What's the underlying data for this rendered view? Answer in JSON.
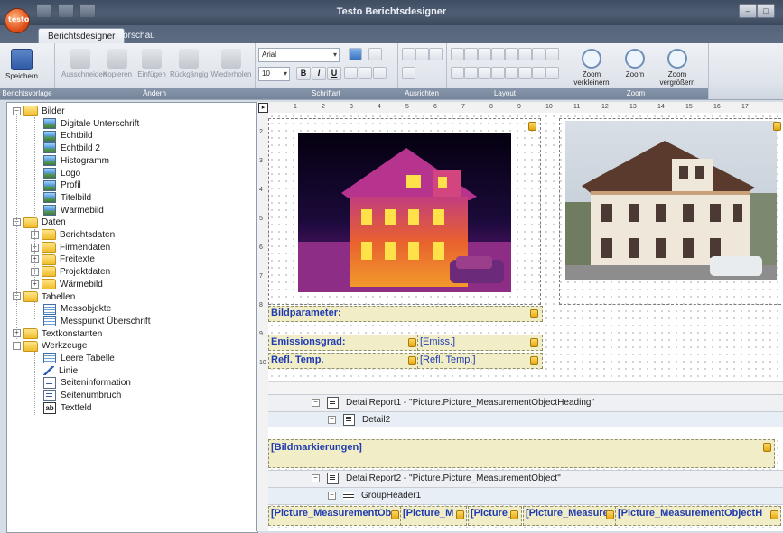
{
  "window": {
    "title": "Testo Berichtsdesigner",
    "logo_text": "testo",
    "buttons": [
      "–",
      "□",
      "✕"
    ]
  },
  "tabs": [
    {
      "label": "Berichtsdesigner",
      "active": true
    },
    {
      "label": "Vorschau",
      "active": false
    }
  ],
  "ribbon": {
    "groups": {
      "berichtsvorlage": {
        "label": "Berichtsvorlage",
        "save_label": "Speichern"
      },
      "aendern": {
        "label": "Ändern",
        "buttons": [
          "Ausschneiden",
          "Kopieren",
          "Einfügen",
          "Rückgängig",
          "Wiederholen"
        ]
      },
      "schriftart": {
        "label": "Schriftart",
        "font": "Arial",
        "size": "10",
        "bold": "B",
        "italic": "I",
        "underline": "U"
      },
      "ausrichten": {
        "label": "Ausrichten"
      },
      "layout": {
        "label": "Layout"
      },
      "zoom": {
        "label": "Zoom",
        "buttons": [
          "Zoom verkleinern",
          "Zoom",
          "Zoom vergrößern"
        ]
      }
    }
  },
  "tree": {
    "nodes": [
      {
        "label": "Bilder",
        "level": 0,
        "kind": "folder",
        "exp": "−"
      },
      {
        "label": "Digitale Unterschrift",
        "level": 1,
        "kind": "img"
      },
      {
        "label": "Echtbild",
        "level": 1,
        "kind": "img"
      },
      {
        "label": "Echtbild 2",
        "level": 1,
        "kind": "img"
      },
      {
        "label": "Histogramm",
        "level": 1,
        "kind": "img"
      },
      {
        "label": "Logo",
        "level": 1,
        "kind": "img"
      },
      {
        "label": "Profil",
        "level": 1,
        "kind": "img"
      },
      {
        "label": "Titelbild",
        "level": 1,
        "kind": "img"
      },
      {
        "label": "Wärmebild",
        "level": 1,
        "kind": "img"
      },
      {
        "label": "Daten",
        "level": 0,
        "kind": "folder",
        "exp": "−"
      },
      {
        "label": "Berichtsdaten",
        "level": 1,
        "kind": "folder",
        "exp": "+"
      },
      {
        "label": "Firmendaten",
        "level": 1,
        "kind": "folder",
        "exp": "+"
      },
      {
        "label": "Freitexte",
        "level": 1,
        "kind": "folder",
        "exp": "+"
      },
      {
        "label": "Projektdaten",
        "level": 1,
        "kind": "folder",
        "exp": "+"
      },
      {
        "label": "Wärmebild",
        "level": 1,
        "kind": "folder",
        "exp": "+"
      },
      {
        "label": "Tabellen",
        "level": 0,
        "kind": "folder",
        "exp": "−"
      },
      {
        "label": "Messobjekte",
        "level": 1,
        "kind": "table"
      },
      {
        "label": "Messpunkt Überschrift",
        "level": 1,
        "kind": "table"
      },
      {
        "label": "Textkonstanten",
        "level": 0,
        "kind": "folder",
        "exp": "+"
      },
      {
        "label": "Werkzeuge",
        "level": 0,
        "kind": "folder",
        "exp": "−"
      },
      {
        "label": "Leere Tabelle",
        "level": 1,
        "kind": "table"
      },
      {
        "label": "Linie",
        "level": 1,
        "kind": "line"
      },
      {
        "label": "Seiteninformation",
        "level": 1,
        "kind": "info"
      },
      {
        "label": "Seitenumbruch",
        "level": 1,
        "kind": "info"
      },
      {
        "label": "Textfeld",
        "level": 1,
        "kind": "txt",
        "icon_text": "ab"
      }
    ]
  },
  "designer": {
    "ruler_button": "▸",
    "ruler_numbers": [
      "1",
      "2",
      "3",
      "4",
      "5",
      "6",
      "7",
      "8",
      "9",
      "10",
      "11",
      "12",
      "13",
      "14",
      "15",
      "16",
      "17"
    ],
    "vruler_numbers": [
      "2",
      "3",
      "4",
      "5",
      "6",
      "7",
      "8",
      "9",
      "10"
    ],
    "fields": {
      "bildparameter": "Bildparameter:",
      "emissionsgrad": "Emissionsgrad:",
      "emiss_value": "[Emiss.]",
      "refl_temp": "Refl. Temp.",
      "refl_value": "[Refl. Temp.]",
      "bildmarkierungen": "[Bildmarkierungen]"
    },
    "bands": {
      "detail_report1": "DetailReport1 - \"Picture.Picture_MeasurementObjectHeading\"",
      "detail2": "Detail2",
      "detail_report2": "DetailReport2 - \"Picture.Picture_MeasurementObject\"",
      "group_header1": "GroupHeader1"
    },
    "table_cells": [
      "[Picture_MeasurementOb",
      "[Picture_M",
      "[Picture_",
      "[Picture_Measure",
      "[Picture_MeasurementObjectH"
    ]
  }
}
